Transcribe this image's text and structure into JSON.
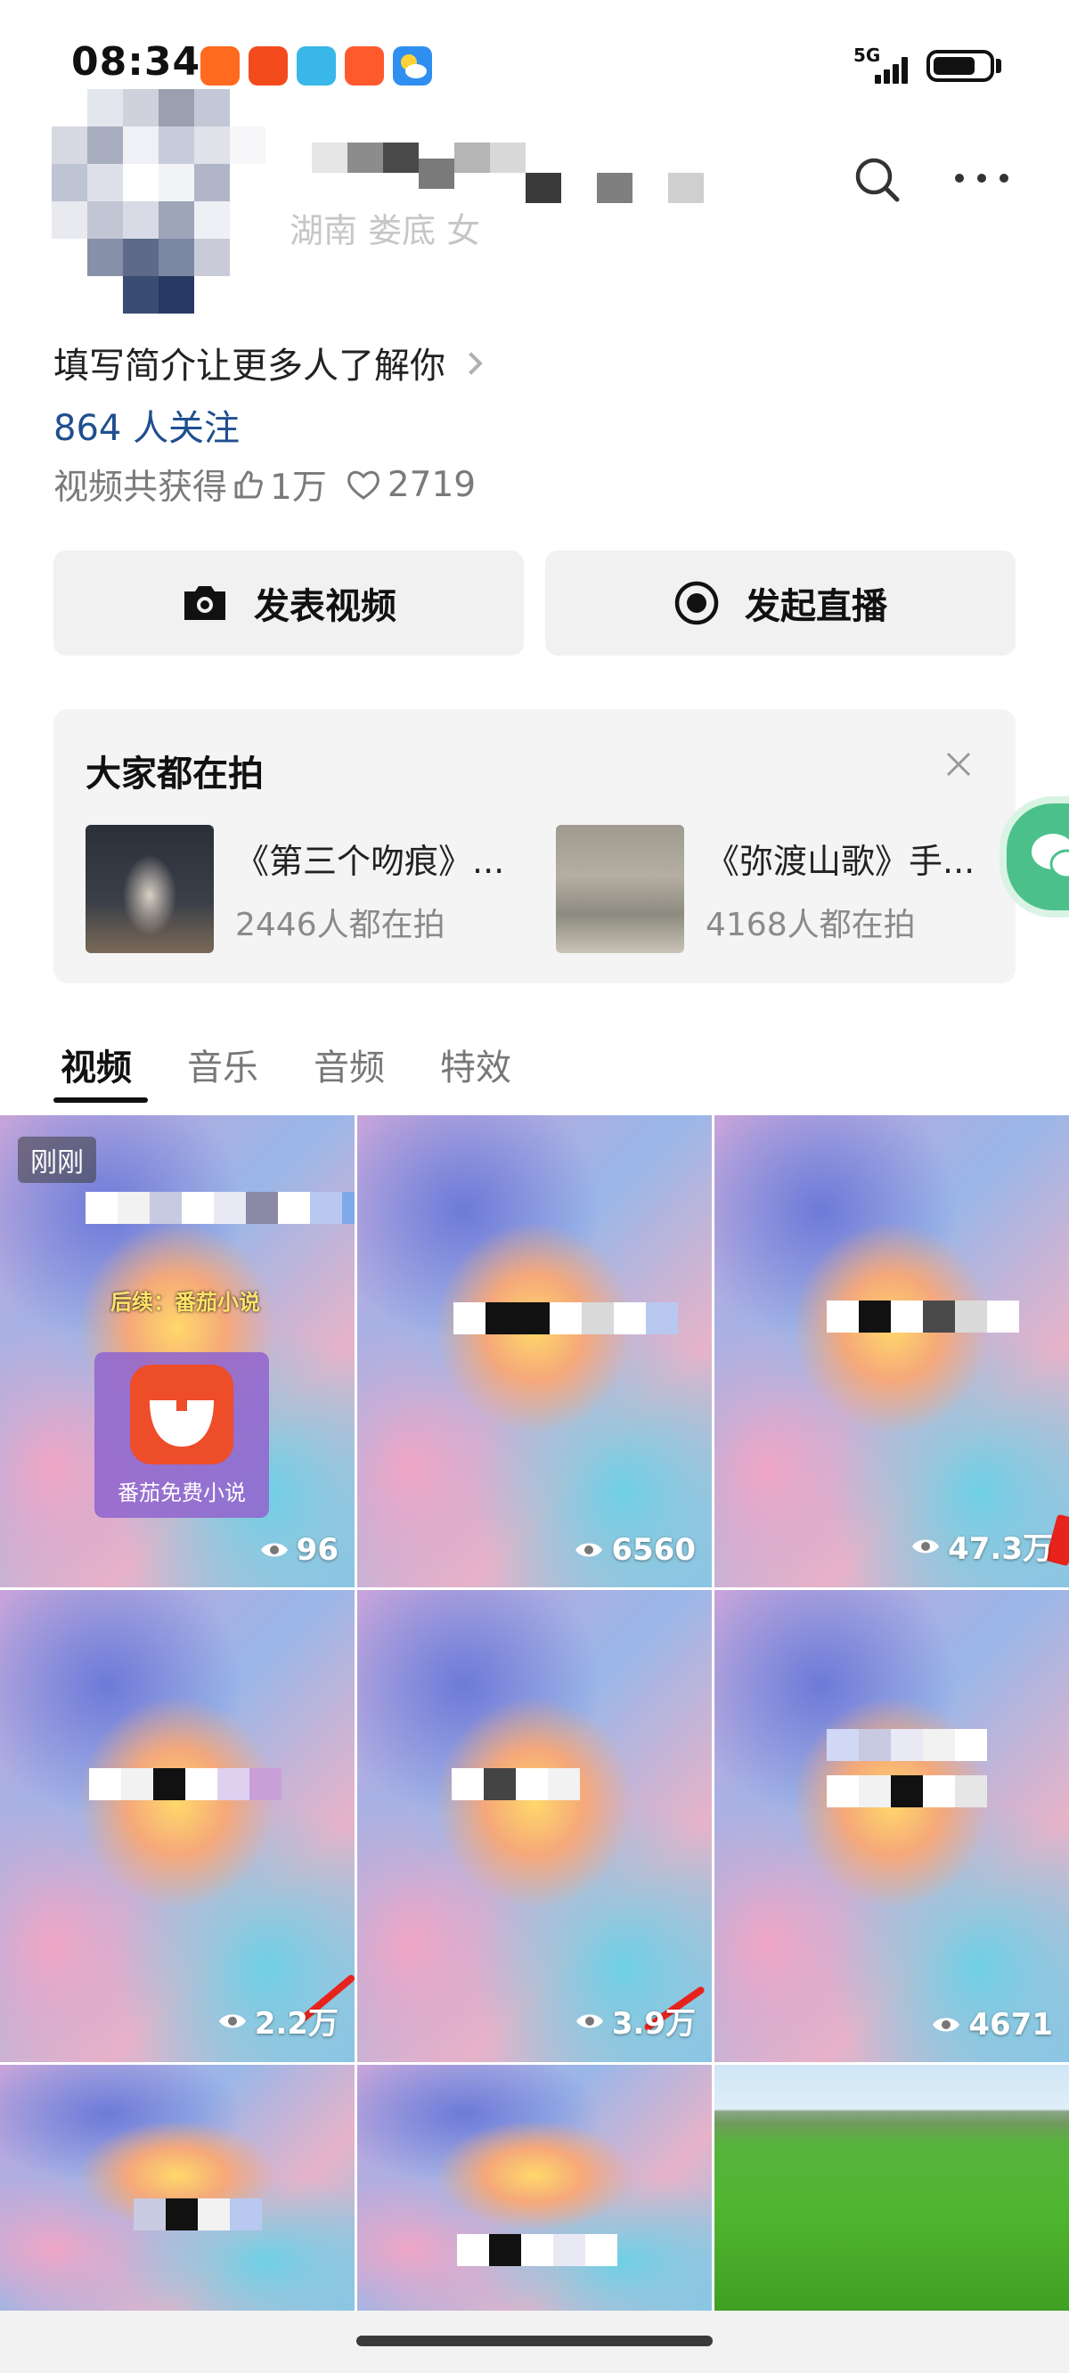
{
  "status_bar": {
    "time": "08:34",
    "network": "5G",
    "notification_icons": [
      "app-icon-orange",
      "app-icon-red",
      "app-icon-cyan",
      "app-icon-red-yellow",
      "weather-icon"
    ]
  },
  "profile": {
    "location_gender": "湖南 娄底 女",
    "bio_prompt": "填写简介让更多人了解你",
    "followers": "864 人关注",
    "stats_prefix": "视频共获得",
    "likes": "1万",
    "hearts": "2719"
  },
  "actions": {
    "post_video": "发表视频",
    "start_live": "发起直播"
  },
  "trending": {
    "title": "大家都在拍",
    "items": [
      {
        "name": "《第三个吻痕》...",
        "count": "2446人都在拍"
      },
      {
        "name": "《弥渡山歌》手...",
        "count": "4168人都在拍"
      }
    ]
  },
  "tabs": [
    {
      "label": "视频",
      "active": true
    },
    {
      "label": "音乐",
      "active": false
    },
    {
      "label": "音频",
      "active": false
    },
    {
      "label": "特效",
      "active": false
    }
  ],
  "videos": [
    {
      "views": "96",
      "badge": "刚刚",
      "caption": "后续：番茄小说",
      "promo": "番茄免费小说"
    },
    {
      "views": "6560"
    },
    {
      "views": "47.3万"
    },
    {
      "views": "2.2万"
    },
    {
      "views": "3.9万"
    },
    {
      "views": "4671"
    },
    {
      "views": ""
    },
    {
      "views": ""
    },
    {
      "views": ""
    }
  ],
  "colors": {
    "follower_link": "#1f4f8f",
    "button_bg": "#f1f1f1",
    "card_bg": "#f4f4f4"
  }
}
